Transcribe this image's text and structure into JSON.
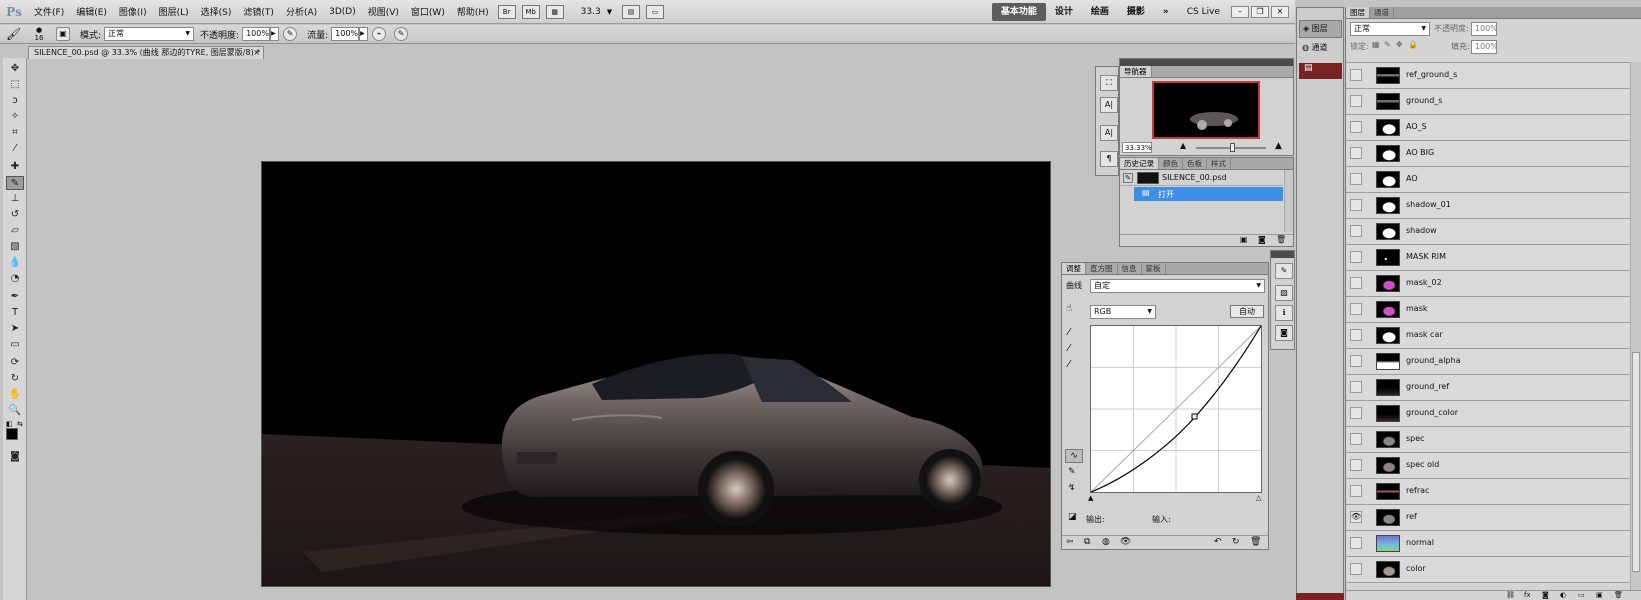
{
  "app": {
    "logo": "Ps"
  },
  "menu": {
    "items": [
      "文件(F)",
      "编辑(E)",
      "图像(I)",
      "图层(L)",
      "选择(S)",
      "滤镜(T)",
      "分析(A)",
      "3D(D)",
      "视图(V)",
      "窗口(W)",
      "帮助(H)"
    ],
    "zoom": "33.3",
    "workspaces": [
      "基本功能",
      "设计",
      "绘画",
      "摄影"
    ],
    "more": "»",
    "cslive": "CS Live"
  },
  "options": {
    "brush_size": "16",
    "mode_label": "模式:",
    "mode_value": "正常",
    "opacity_label": "不透明度:",
    "opacity_value": "100%",
    "flow_label": "流量:",
    "flow_value": "100%"
  },
  "document": {
    "tab_title": "SILENCE_00.psd @ 33.3% (曲线  那边的TYRE, 图层蒙版/8) *"
  },
  "navigator": {
    "tab": "导航器",
    "zoom": "33.33%"
  },
  "history": {
    "tabs": [
      "历史记录",
      "颜色",
      "色板",
      "样式"
    ],
    "items": [
      "SILENCE_00.psd",
      "打开"
    ]
  },
  "adjustments": {
    "tabs": [
      "调整",
      "直方图",
      "信息",
      "蒙板"
    ],
    "preset_label": "曲线",
    "preset_value": "自定",
    "channel": "RGB",
    "auto_button": "自动",
    "output_label": "输出:",
    "input_label": "输入:"
  },
  "side_icons": {
    "tab_layers": "图层",
    "tab_channels": "通道"
  },
  "layers": {
    "tabs": [
      "图层",
      "通道"
    ],
    "blend_mode": "正常",
    "opacity_label": "不透明度:",
    "opacity_value": "100%",
    "lock_label": "锁定:",
    "fill_label": "填充:",
    "fill_value": "100%",
    "rows": [
      {
        "name": "ref_ground_s",
        "visible": false,
        "thumb": "stripe"
      },
      {
        "name": "ground_s",
        "visible": false,
        "thumb": "stripe"
      },
      {
        "name": "AO_S",
        "visible": false,
        "thumb": "car-white"
      },
      {
        "name": "AO BIG",
        "visible": false,
        "thumb": "car-white"
      },
      {
        "name": "AO",
        "visible": false,
        "thumb": "car-white"
      },
      {
        "name": "shadow_01",
        "visible": false,
        "thumb": "car-white"
      },
      {
        "name": "shadow",
        "visible": false,
        "thumb": "car-white"
      },
      {
        "name": "MASK RIM",
        "visible": false,
        "thumb": "dots"
      },
      {
        "name": "mask_02",
        "visible": false,
        "thumb": "car-magenta"
      },
      {
        "name": "mask",
        "visible": false,
        "thumb": "car-magenta"
      },
      {
        "name": "mask car",
        "visible": false,
        "thumb": "car-white"
      },
      {
        "name": "ground_alpha",
        "visible": false,
        "thumb": "ground-white"
      },
      {
        "name": "ground_ref",
        "visible": false,
        "thumb": "dark"
      },
      {
        "name": "ground_color",
        "visible": false,
        "thumb": "dark"
      },
      {
        "name": "spec",
        "visible": false,
        "thumb": "car-grey"
      },
      {
        "name": "spec old",
        "visible": false,
        "thumb": "car-grey"
      },
      {
        "name": "refrac",
        "visible": false,
        "thumb": "stripe-red"
      },
      {
        "name": "ref",
        "visible": true,
        "thumb": "car-grey"
      },
      {
        "name": "normal",
        "visible": false,
        "thumb": "normal"
      },
      {
        "name": "color",
        "visible": false,
        "thumb": "car-color"
      }
    ]
  },
  "colors": {
    "accent_selection": "#3d8ee6",
    "workspace_active": "#5d5d5d",
    "panel_bg": "#d2d2d2",
    "canvas_bg": "#000000"
  }
}
